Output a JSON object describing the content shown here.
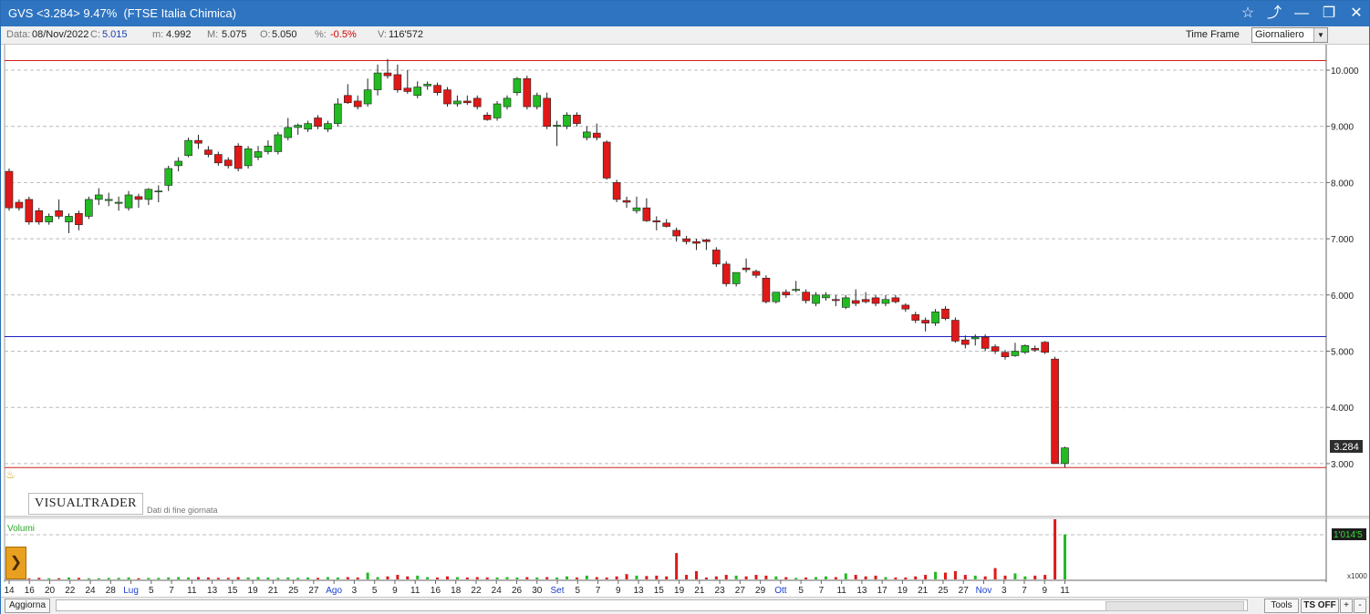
{
  "window": {
    "title": "GVS <3.284> 9.47%  (FTSE Italia Chimica)"
  },
  "icons": {
    "favorite": "star-icon",
    "draw": "pencil-icon",
    "minimize": "minimize-icon",
    "restore": "restore-icon",
    "close": "close-icon"
  },
  "info": {
    "date_label": "Data:",
    "date_value": "08/Nov/2022",
    "close_label": "C:",
    "close_value": "5.015",
    "min_label": "m:",
    "min_value": "4.992",
    "max_label": "M:",
    "max_value": "5.075",
    "open_label": "O:",
    "open_value": "5.050",
    "pct_label": "%:",
    "pct_value": "-0.5%",
    "vol_label": "V:",
    "vol_value": "116'572",
    "timeframe_label": "Time Frame",
    "timeframe_value": "Giornaliero"
  },
  "logo_text": "VISUALTRADER",
  "eod_text": "Dati di fine giornata",
  "volume_label": "Volumi",
  "volume_marker": "1'014'5",
  "volume_multiplier": "x1000",
  "current_price_label": "3.284",
  "bottom": {
    "refresh_label": "Aggiorna",
    "tools_label": "Tools",
    "ts_off_label": "TS OFF",
    "plus_label": "+",
    "minus_label": "-"
  },
  "colors": {
    "up": "#22bb22",
    "down": "#e01818",
    "resistance": "#d42020",
    "support": "#2020c0",
    "titlebar": "#2f74c0"
  },
  "chart_data": {
    "type": "candlestick",
    "price_axis": {
      "min": 2.9,
      "max": 10.2,
      "ticks": [
        "10.000",
        "9.000",
        "8.000",
        "7.000",
        "6.000",
        "5.000",
        "4.000",
        "3.000"
      ]
    },
    "grid": true,
    "horizontal_lines": [
      {
        "kind": "resistance",
        "value": 10.17
      },
      {
        "kind": "support",
        "value": 5.26
      },
      {
        "kind": "support-low",
        "value": 2.93
      }
    ],
    "x_labels": [
      {
        "label": "14",
        "accent": false
      },
      {
        "label": "16",
        "accent": false
      },
      {
        "label": "20",
        "accent": false
      },
      {
        "label": "22",
        "accent": false
      },
      {
        "label": "24",
        "accent": false
      },
      {
        "label": "28",
        "accent": false
      },
      {
        "label": "Lug",
        "accent": true
      },
      {
        "label": "5",
        "accent": false
      },
      {
        "label": "7",
        "accent": false
      },
      {
        "label": "11",
        "accent": false
      },
      {
        "label": "13",
        "accent": false
      },
      {
        "label": "15",
        "accent": false
      },
      {
        "label": "19",
        "accent": false
      },
      {
        "label": "21",
        "accent": false
      },
      {
        "label": "25",
        "accent": false
      },
      {
        "label": "27",
        "accent": false
      },
      {
        "label": "Ago",
        "accent": true
      },
      {
        "label": "3",
        "accent": false
      },
      {
        "label": "5",
        "accent": false
      },
      {
        "label": "9",
        "accent": false
      },
      {
        "label": "11",
        "accent": false
      },
      {
        "label": "16",
        "accent": false
      },
      {
        "label": "18",
        "accent": false
      },
      {
        "label": "22",
        "accent": false
      },
      {
        "label": "24",
        "accent": false
      },
      {
        "label": "26",
        "accent": false
      },
      {
        "label": "30",
        "accent": false
      },
      {
        "label": "Set",
        "accent": true
      },
      {
        "label": "5",
        "accent": false
      },
      {
        "label": "7",
        "accent": false
      },
      {
        "label": "9",
        "accent": false
      },
      {
        "label": "13",
        "accent": false
      },
      {
        "label": "15",
        "accent": false
      },
      {
        "label": "19",
        "accent": false
      },
      {
        "label": "21",
        "accent": false
      },
      {
        "label": "23",
        "accent": false
      },
      {
        "label": "27",
        "accent": false
      },
      {
        "label": "29",
        "accent": false
      },
      {
        "label": "Ott",
        "accent": true
      },
      {
        "label": "5",
        "accent": false
      },
      {
        "label": "7",
        "accent": false
      },
      {
        "label": "11",
        "accent": false
      },
      {
        "label": "13",
        "accent": false
      },
      {
        "label": "17",
        "accent": false
      },
      {
        "label": "19",
        "accent": false
      },
      {
        "label": "21",
        "accent": false
      },
      {
        "label": "25",
        "accent": false
      },
      {
        "label": "27",
        "accent": false
      },
      {
        "label": "Nov",
        "accent": true
      },
      {
        "label": "3",
        "accent": false
      },
      {
        "label": "7",
        "accent": false
      },
      {
        "label": "9",
        "accent": false
      },
      {
        "label": "11",
        "accent": false
      }
    ],
    "candles": [
      {
        "o": 8.2,
        "h": 8.25,
        "l": 7.5,
        "c": 7.55
      },
      {
        "o": 7.65,
        "h": 7.7,
        "l": 7.5,
        "c": 7.55
      },
      {
        "o": 7.7,
        "h": 7.75,
        "l": 7.25,
        "c": 7.3
      },
      {
        "o": 7.5,
        "h": 7.55,
        "l": 7.25,
        "c": 7.3
      },
      {
        "o": 7.3,
        "h": 7.45,
        "l": 7.25,
        "c": 7.4
      },
      {
        "o": 7.5,
        "h": 7.7,
        "l": 7.35,
        "c": 7.4
      },
      {
        "o": 7.3,
        "h": 7.45,
        "l": 7.1,
        "c": 7.4
      },
      {
        "o": 7.45,
        "h": 7.5,
        "l": 7.15,
        "c": 7.25
      },
      {
        "o": 7.4,
        "h": 7.75,
        "l": 7.35,
        "c": 7.7
      },
      {
        "o": 7.7,
        "h": 7.9,
        "l": 7.6,
        "c": 7.78
      },
      {
        "o": 7.68,
        "h": 7.82,
        "l": 7.58,
        "c": 7.7
      },
      {
        "o": 7.63,
        "h": 7.75,
        "l": 7.5,
        "c": 7.65
      },
      {
        "o": 7.55,
        "h": 7.85,
        "l": 7.5,
        "c": 7.78
      },
      {
        "o": 7.75,
        "h": 7.8,
        "l": 7.55,
        "c": 7.7
      },
      {
        "o": 7.7,
        "h": 7.9,
        "l": 7.6,
        "c": 7.88
      },
      {
        "o": 7.85,
        "h": 7.95,
        "l": 7.65,
        "c": 7.85
      },
      {
        "o": 7.95,
        "h": 8.3,
        "l": 7.85,
        "c": 8.25
      },
      {
        "o": 8.3,
        "h": 8.45,
        "l": 8.2,
        "c": 8.38
      },
      {
        "o": 8.48,
        "h": 8.8,
        "l": 8.45,
        "c": 8.75
      },
      {
        "o": 8.75,
        "h": 8.85,
        "l": 8.6,
        "c": 8.7
      },
      {
        "o": 8.58,
        "h": 8.65,
        "l": 8.45,
        "c": 8.5
      },
      {
        "o": 8.5,
        "h": 8.55,
        "l": 8.3,
        "c": 8.35
      },
      {
        "o": 8.4,
        "h": 8.45,
        "l": 8.25,
        "c": 8.3
      },
      {
        "o": 8.65,
        "h": 8.7,
        "l": 8.2,
        "c": 8.25
      },
      {
        "o": 8.3,
        "h": 8.65,
        "l": 8.25,
        "c": 8.6
      },
      {
        "o": 8.45,
        "h": 8.65,
        "l": 8.4,
        "c": 8.55
      },
      {
        "o": 8.55,
        "h": 8.75,
        "l": 8.5,
        "c": 8.65
      },
      {
        "o": 8.55,
        "h": 8.9,
        "l": 8.5,
        "c": 8.85
      },
      {
        "o": 8.8,
        "h": 9.15,
        "l": 8.75,
        "c": 8.98
      },
      {
        "o": 8.98,
        "h": 9.05,
        "l": 8.85,
        "c": 9.02
      },
      {
        "o": 8.95,
        "h": 9.1,
        "l": 8.9,
        "c": 9.05
      },
      {
        "o": 9.15,
        "h": 9.2,
        "l": 8.95,
        "c": 9.0
      },
      {
        "o": 8.95,
        "h": 9.1,
        "l": 8.9,
        "c": 9.05
      },
      {
        "o": 9.05,
        "h": 9.5,
        "l": 9.0,
        "c": 9.4
      },
      {
        "o": 9.55,
        "h": 9.75,
        "l": 9.4,
        "c": 9.42
      },
      {
        "o": 9.45,
        "h": 9.55,
        "l": 9.3,
        "c": 9.35
      },
      {
        "o": 9.4,
        "h": 9.85,
        "l": 9.35,
        "c": 9.65
      },
      {
        "o": 9.65,
        "h": 10.1,
        "l": 9.55,
        "c": 9.95
      },
      {
        "o": 9.95,
        "h": 10.2,
        "l": 9.85,
        "c": 9.9
      },
      {
        "o": 9.92,
        "h": 10.1,
        "l": 9.6,
        "c": 9.65
      },
      {
        "o": 9.68,
        "h": 10.0,
        "l": 9.58,
        "c": 9.62
      },
      {
        "o": 9.55,
        "h": 9.8,
        "l": 9.5,
        "c": 9.7
      },
      {
        "o": 9.72,
        "h": 9.8,
        "l": 9.65,
        "c": 9.75
      },
      {
        "o": 9.73,
        "h": 9.78,
        "l": 9.55,
        "c": 9.6
      },
      {
        "o": 9.65,
        "h": 9.7,
        "l": 9.35,
        "c": 9.4
      },
      {
        "o": 9.4,
        "h": 9.55,
        "l": 9.35,
        "c": 9.45
      },
      {
        "o": 9.45,
        "h": 9.55,
        "l": 9.38,
        "c": 9.42
      },
      {
        "o": 9.5,
        "h": 9.55,
        "l": 9.3,
        "c": 9.35
      },
      {
        "o": 9.2,
        "h": 9.25,
        "l": 9.1,
        "c": 9.12
      },
      {
        "o": 9.15,
        "h": 9.45,
        "l": 9.1,
        "c": 9.4
      },
      {
        "o": 9.35,
        "h": 9.55,
        "l": 9.3,
        "c": 9.5
      },
      {
        "o": 9.6,
        "h": 9.88,
        "l": 9.55,
        "c": 9.85
      },
      {
        "o": 9.85,
        "h": 9.9,
        "l": 9.3,
        "c": 9.35
      },
      {
        "o": 9.35,
        "h": 9.6,
        "l": 9.3,
        "c": 9.55
      },
      {
        "o": 9.5,
        "h": 9.6,
        "l": 8.95,
        "c": 9.0
      },
      {
        "o": 9.0,
        "h": 9.1,
        "l": 8.65,
        "c": 9.02
      },
      {
        "o": 9.0,
        "h": 9.25,
        "l": 8.95,
        "c": 9.2
      },
      {
        "o": 9.2,
        "h": 9.25,
        "l": 9.0,
        "c": 9.05
      },
      {
        "o": 8.8,
        "h": 9.0,
        "l": 8.75,
        "c": 8.9
      },
      {
        "o": 8.88,
        "h": 9.05,
        "l": 8.75,
        "c": 8.8
      },
      {
        "o": 8.72,
        "h": 8.75,
        "l": 8.05,
        "c": 8.08
      },
      {
        "o": 8.0,
        "h": 8.05,
        "l": 7.65,
        "c": 7.7
      },
      {
        "o": 7.68,
        "h": 7.75,
        "l": 7.55,
        "c": 7.65
      },
      {
        "o": 7.5,
        "h": 7.75,
        "l": 7.45,
        "c": 7.55
      },
      {
        "o": 7.55,
        "h": 7.72,
        "l": 7.3,
        "c": 7.32
      },
      {
        "o": 7.32,
        "h": 7.4,
        "l": 7.15,
        "c": 7.3
      },
      {
        "o": 7.28,
        "h": 7.35,
        "l": 7.2,
        "c": 7.22
      },
      {
        "o": 7.15,
        "h": 7.2,
        "l": 6.95,
        "c": 7.05
      },
      {
        "o": 7.0,
        "h": 7.05,
        "l": 6.9,
        "c": 6.95
      },
      {
        "o": 6.95,
        "h": 7.0,
        "l": 6.8,
        "c": 6.92
      },
      {
        "o": 6.98,
        "h": 7.0,
        "l": 6.8,
        "c": 6.95
      },
      {
        "o": 6.8,
        "h": 6.85,
        "l": 6.5,
        "c": 6.55
      },
      {
        "o": 6.55,
        "h": 6.6,
        "l": 6.15,
        "c": 6.2
      },
      {
        "o": 6.2,
        "h": 6.4,
        "l": 6.15,
        "c": 6.4
      },
      {
        "o": 6.48,
        "h": 6.65,
        "l": 6.4,
        "c": 6.45
      },
      {
        "o": 6.42,
        "h": 6.45,
        "l": 6.3,
        "c": 6.35
      },
      {
        "o": 6.3,
        "h": 6.35,
        "l": 5.85,
        "c": 5.88
      },
      {
        "o": 5.88,
        "h": 6.05,
        "l": 5.85,
        "c": 6.05
      },
      {
        "o": 6.05,
        "h": 6.1,
        "l": 5.95,
        "c": 6.0
      },
      {
        "o": 6.08,
        "h": 6.25,
        "l": 6.05,
        "c": 6.1
      },
      {
        "o": 6.05,
        "h": 6.1,
        "l": 5.85,
        "c": 5.9
      },
      {
        "o": 5.85,
        "h": 6.05,
        "l": 5.8,
        "c": 6.0
      },
      {
        "o": 5.95,
        "h": 6.05,
        "l": 5.9,
        "c": 6.0
      },
      {
        "o": 5.92,
        "h": 6.0,
        "l": 5.8,
        "c": 5.9
      },
      {
        "o": 5.78,
        "h": 6.0,
        "l": 5.75,
        "c": 5.95
      },
      {
        "o": 5.9,
        "h": 6.1,
        "l": 5.8,
        "c": 5.85
      },
      {
        "o": 5.92,
        "h": 6.05,
        "l": 5.85,
        "c": 5.88
      },
      {
        "o": 5.95,
        "h": 6.0,
        "l": 5.8,
        "c": 5.85
      },
      {
        "o": 5.85,
        "h": 6.0,
        "l": 5.8,
        "c": 5.92
      },
      {
        "o": 5.95,
        "h": 6.0,
        "l": 5.85,
        "c": 5.88
      },
      {
        "o": 5.82,
        "h": 5.85,
        "l": 5.7,
        "c": 5.75
      },
      {
        "o": 5.65,
        "h": 5.7,
        "l": 5.5,
        "c": 5.55
      },
      {
        "o": 5.55,
        "h": 5.6,
        "l": 5.35,
        "c": 5.5
      },
      {
        "o": 5.5,
        "h": 5.75,
        "l": 5.45,
        "c": 5.7
      },
      {
        "o": 5.75,
        "h": 5.8,
        "l": 5.55,
        "c": 5.58
      },
      {
        "o": 5.55,
        "h": 5.6,
        "l": 5.15,
        "c": 5.18
      },
      {
        "o": 5.2,
        "h": 5.28,
        "l": 5.05,
        "c": 5.12
      },
      {
        "o": 5.22,
        "h": 5.3,
        "l": 5.1,
        "c": 5.25
      },
      {
        "o": 5.25,
        "h": 5.3,
        "l": 5.0,
        "c": 5.05
      },
      {
        "o": 5.08,
        "h": 5.12,
        "l": 4.95,
        "c": 5.0
      },
      {
        "o": 4.98,
        "h": 5.02,
        "l": 4.85,
        "c": 4.9
      },
      {
        "o": 4.92,
        "h": 5.15,
        "l": 4.9,
        "c": 5.0
      },
      {
        "o": 4.98,
        "h": 5.12,
        "l": 4.95,
        "c": 5.1
      },
      {
        "o": 5.05,
        "h": 5.1,
        "l": 4.99,
        "c": 5.02
      },
      {
        "o": 5.16,
        "h": 5.18,
        "l": 4.95,
        "c": 4.98
      },
      {
        "o": 4.86,
        "h": 4.9,
        "l": 3.0,
        "c": 3.0
      },
      {
        "o": 3.0,
        "h": 3.3,
        "l": 2.93,
        "c": 3.28
      }
    ],
    "volumes": [
      3,
      3,
      2,
      4,
      3,
      3,
      5,
      4,
      3,
      3,
      4,
      4,
      5,
      3,
      4,
      4,
      5,
      6,
      5,
      6,
      5,
      4,
      4,
      6,
      5,
      6,
      5,
      4,
      5,
      4,
      5,
      4,
      6,
      5,
      6,
      5,
      18,
      6,
      8,
      12,
      8,
      10,
      6,
      5,
      8,
      6,
      5,
      6,
      5,
      5,
      6,
      5,
      6,
      5,
      6,
      5,
      8,
      5,
      10,
      6,
      5,
      8,
      14,
      10,
      9,
      10,
      8,
      70,
      12,
      22,
      5,
      8,
      12,
      10,
      8,
      12,
      10,
      8,
      6,
      4,
      5,
      6,
      8,
      6,
      16,
      12,
      8,
      10,
      6,
      5,
      5,
      8,
      12,
      20,
      18,
      22,
      12,
      10,
      8,
      30,
      10,
      16,
      8,
      10,
      12,
      160,
      120
    ]
  }
}
